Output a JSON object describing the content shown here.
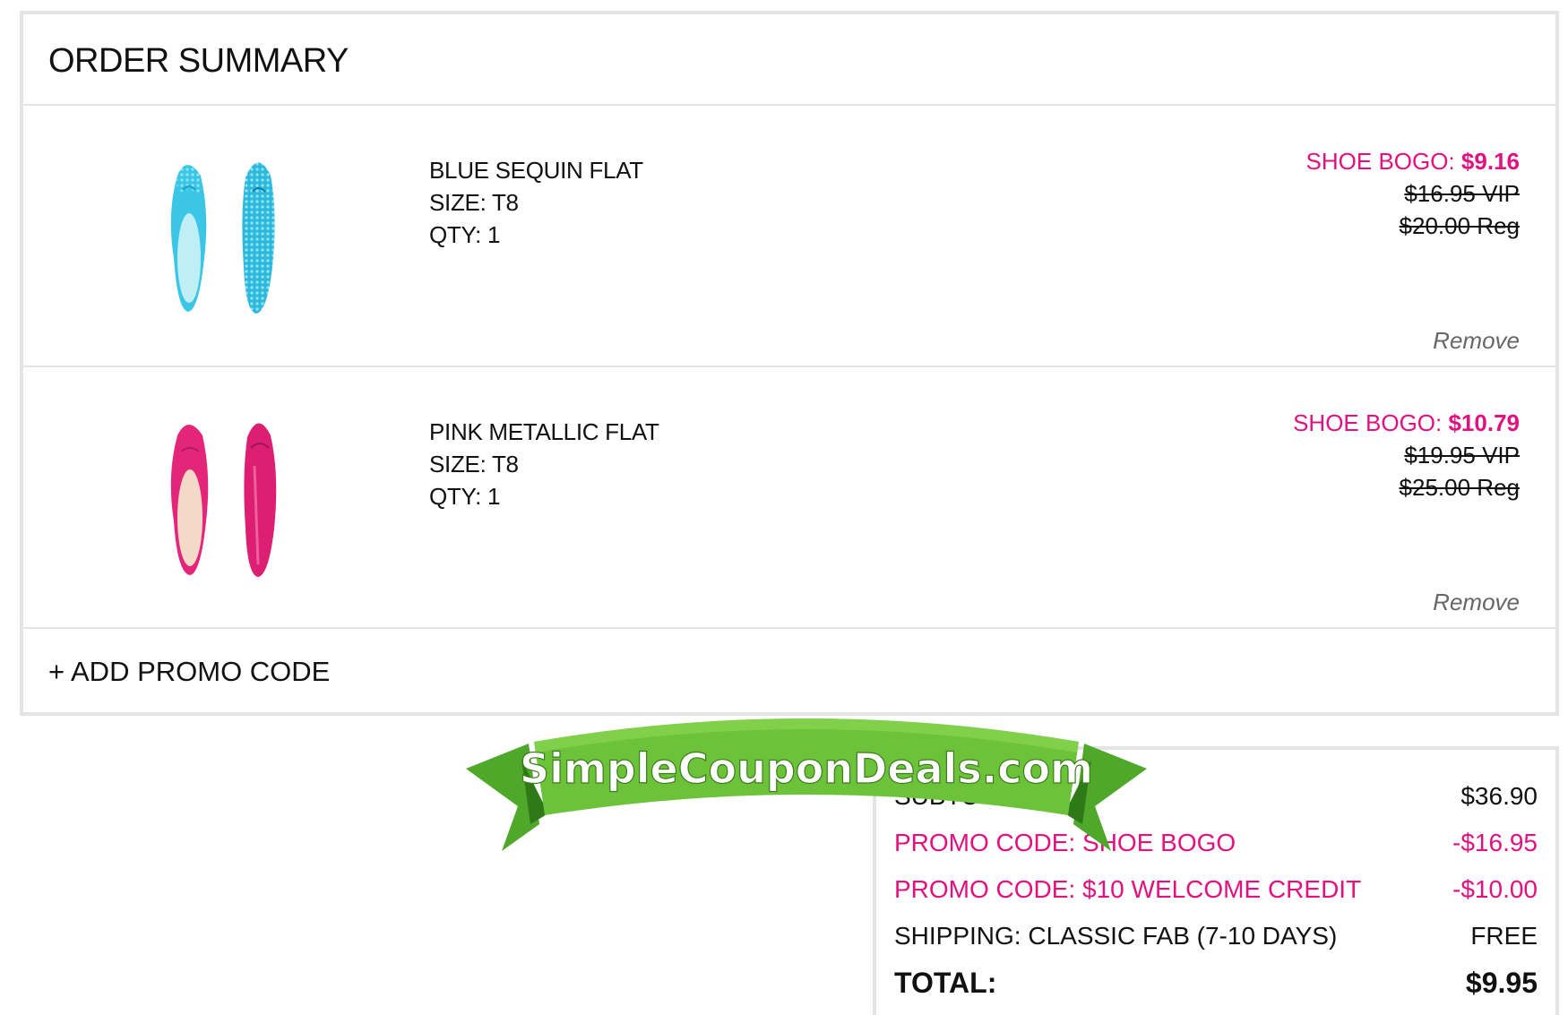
{
  "order_summary": {
    "title": "ORDER SUMMARY",
    "items": [
      {
        "name": "BLUE SEQUIN FLAT",
        "size": "SIZE: T8",
        "qty": "QTY: 1",
        "promo_label": "SHOE BOGO: ",
        "promo_price": "$9.16",
        "vip_price": "$16.95 VIP",
        "reg_price": "$20.00 Reg",
        "remove_label": "Remove",
        "color": "#3cc6e6"
      },
      {
        "name": "PINK METALLIC FLAT",
        "size": "SIZE: T8",
        "qty": "QTY: 1",
        "promo_label": "SHOE BOGO: ",
        "promo_price": "$10.79",
        "vip_price": "$19.95 VIP",
        "reg_price": "$25.00 Reg",
        "remove_label": "Remove",
        "color": "#e4267a"
      }
    ],
    "add_promo_label": "+ ADD PROMO CODE"
  },
  "totals": {
    "subtotal_label": "SUBTOTAL",
    "subtotal_value": "$36.90",
    "promo1_label": "PROMO CODE: SHOE BOGO",
    "promo1_value": "-$16.95",
    "promo2_label": "PROMO CODE: $10 WELCOME CREDIT",
    "promo2_value": "-$10.00",
    "shipping_label": "SHIPPING: CLASSIC FAB (7-10 DAYS)",
    "shipping_value": "FREE",
    "total_label": "TOTAL:",
    "total_value": "$9.95"
  },
  "watermark": {
    "text": "SimpleCouponDeals.com",
    "color": "#6cc33a"
  },
  "colors": {
    "accent": "#e3107f",
    "border": "#e4e4e4"
  }
}
